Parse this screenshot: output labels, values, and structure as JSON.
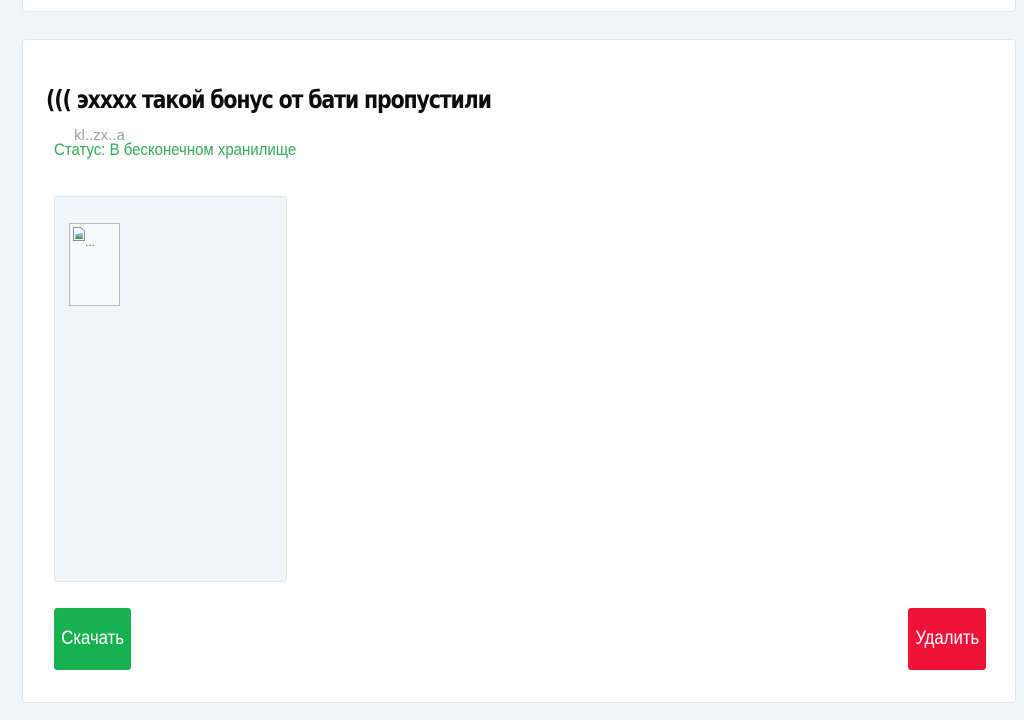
{
  "card": {
    "title": "((( эхххх такой бонус от бати пропустили",
    "image_alt": "...",
    "filename_fragment": "kl..zx..a",
    "status": "Статус: В бесконечном хранилище",
    "download_label": "Скачать",
    "delete_label": "Удалить"
  },
  "colors": {
    "status": "#35a85a",
    "download_button": "#17b24f",
    "delete_button": "#ee1238",
    "background": "#f2f5f8"
  },
  "icons": {
    "broken_image": "broken-image-icon"
  }
}
